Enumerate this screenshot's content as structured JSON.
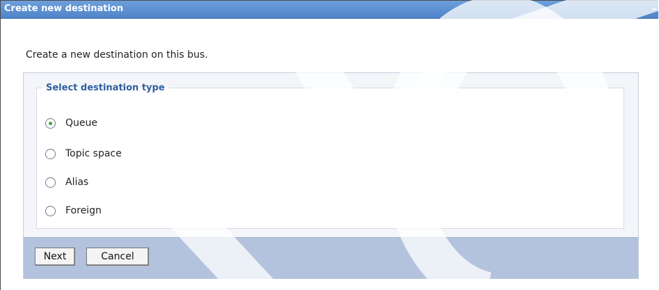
{
  "window": {
    "title": "Create new destination",
    "minimize_glyph": "–"
  },
  "description": "Create a new destination on this bus.",
  "destination_type": {
    "legend": "Select destination type",
    "selected": "Queue",
    "options": [
      {
        "label": "Queue",
        "checked": true
      },
      {
        "label": "Topic space",
        "checked": false
      },
      {
        "label": "Alias",
        "checked": false
      },
      {
        "label": "Foreign",
        "checked": false
      }
    ]
  },
  "buttons": {
    "next_label": "Next",
    "cancel_label": "Cancel"
  },
  "colors": {
    "titlebar": "#5a8dd0",
    "legend_text": "#2f5e9f",
    "button_bar": "#b4c3dd",
    "radio_selected_dot": "#3aa83a"
  }
}
